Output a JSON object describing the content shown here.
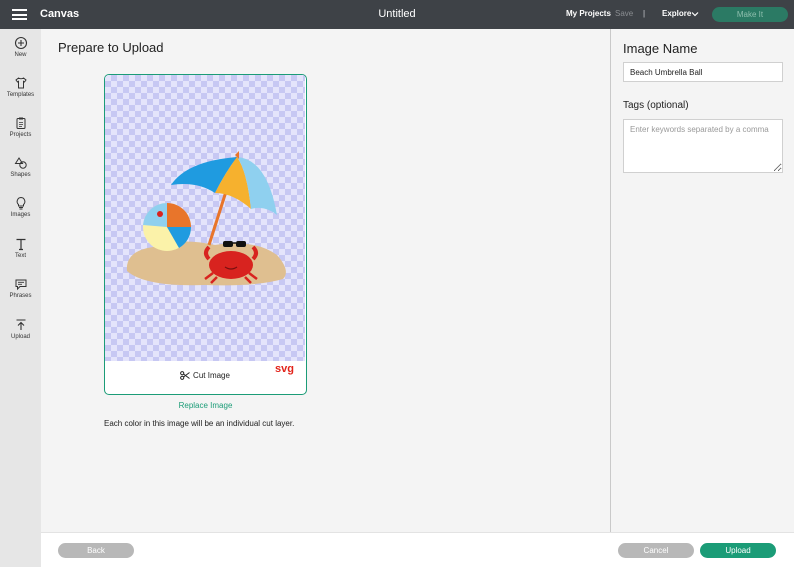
{
  "topbar": {
    "app_name": "Canvas",
    "document_title": "Untitled",
    "my_projects": "My Projects",
    "save": "Save",
    "separator": "|",
    "explore": "Explore",
    "make_it": "Make It"
  },
  "sidebar": {
    "items": [
      {
        "label": "New",
        "icon": "plus-circle-icon"
      },
      {
        "label": "Templates",
        "icon": "shirt-icon"
      },
      {
        "label": "Projects",
        "icon": "clipboard-icon"
      },
      {
        "label": "Shapes",
        "icon": "shapes-icon"
      },
      {
        "label": "Images",
        "icon": "lightbulb-icon"
      },
      {
        "label": "Text",
        "icon": "text-icon"
      },
      {
        "label": "Phrases",
        "icon": "speech-bubble-icon"
      },
      {
        "label": "Upload",
        "icon": "upload-icon"
      }
    ]
  },
  "main": {
    "title": "Prepare to Upload",
    "cut_image_label": "Cut Image",
    "file_type_badge": "svg",
    "replace_image": "Replace Image",
    "note": "Each color in this image will be an individual cut layer."
  },
  "right_panel": {
    "image_name_title": "Image Name",
    "image_name_value": "Beach Umbrella Ball",
    "tags_label": "Tags (optional)",
    "tags_placeholder": "Enter keywords separated by a comma"
  },
  "footer": {
    "back": "Back",
    "cancel": "Cancel",
    "upload": "Upload"
  },
  "colors": {
    "accent": "#1b9c77",
    "topbar": "#3e4247",
    "make_it_bg": "#2b7a64",
    "badge": "#e2231a"
  }
}
